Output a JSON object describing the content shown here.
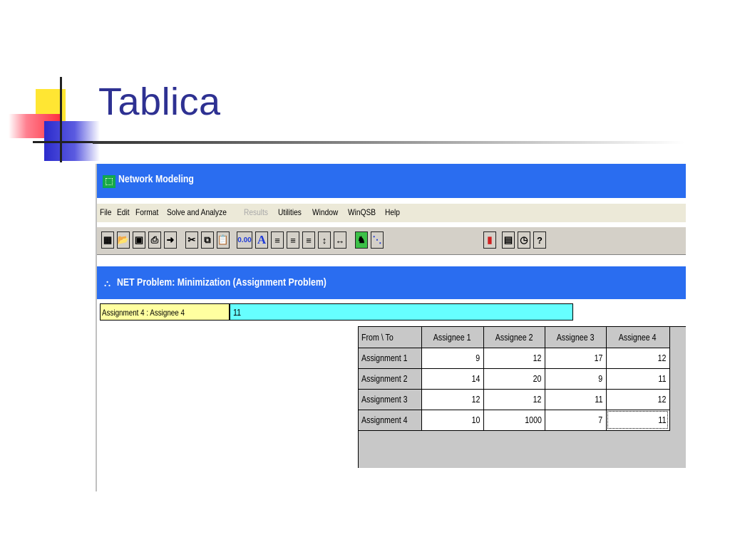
{
  "slide": {
    "title": "Tablica"
  },
  "window": {
    "title": "Network Modeling",
    "menu": [
      {
        "label": "File",
        "disabled": false
      },
      {
        "label": "Edit",
        "disabled": false
      },
      {
        "label": "Format",
        "disabled": false
      },
      {
        "label": "Solve and Analyze",
        "disabled": false
      },
      {
        "label": "Results",
        "disabled": true
      },
      {
        "label": "Utilities",
        "disabled": false
      },
      {
        "label": "Window",
        "disabled": false
      },
      {
        "label": "WinQSB",
        "disabled": false
      },
      {
        "label": "Help",
        "disabled": false
      }
    ],
    "toolbar": {
      "number_format_label": "0.00",
      "font_label": "A"
    },
    "icons": {
      "app": "network-icon",
      "document": "network-doc-icon"
    },
    "accent_color": "#2a6df0"
  },
  "document": {
    "title": "NET Problem: Minimization (Assignment Problem)",
    "cell_reference": "Assignment 4 : Assignee 4",
    "cell_value": "11",
    "cell_reference_color": "#ffffa0",
    "cell_value_color": "#66ffff"
  },
  "table": {
    "corner": "From \\ To",
    "columns": [
      "Assignee 1",
      "Assignee 2",
      "Assignee 3",
      "Assignee 4"
    ],
    "rows": [
      {
        "label": "Assignment 1",
        "values": [
          "9",
          "12",
          "17",
          "12"
        ]
      },
      {
        "label": "Assignment 2",
        "values": [
          "14",
          "20",
          "9",
          "11"
        ]
      },
      {
        "label": "Assignment 3",
        "values": [
          "12",
          "12",
          "11",
          "12"
        ]
      },
      {
        "label": "Assignment 4",
        "values": [
          "10",
          "1000",
          "7",
          "11"
        ]
      }
    ],
    "selected_cell": "Assignment 4 : Assignee 4"
  }
}
